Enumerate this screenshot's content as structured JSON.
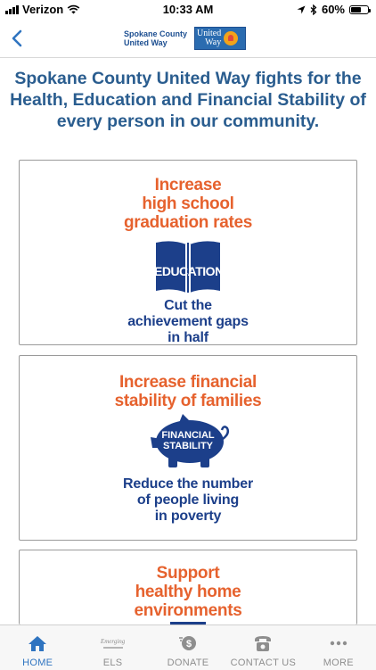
{
  "status_bar": {
    "carrier": "Verizon",
    "time": "10:33 AM",
    "battery": "60%",
    "battery_level": 0.6
  },
  "header": {
    "org_line1": "Spokane County",
    "org_line2": "United Way",
    "logo_line1": "United",
    "logo_line2": "Way"
  },
  "headline": "Spokane County United Way fights for the Health, Education and Financial Stability of every person in our community.",
  "cards": [
    {
      "goal": [
        "Increase",
        "high school",
        "graduation rates"
      ],
      "emblem": "EDUCATION",
      "impact": [
        "Cut the",
        "achievement gaps",
        "in half"
      ]
    },
    {
      "goal": [
        "Increase financial",
        "stability of families"
      ],
      "emblem_line1": "FINANCIAL",
      "emblem_line2": "STABILITY",
      "impact": [
        "Reduce the number",
        "of people living",
        "in poverty"
      ]
    },
    {
      "goal": [
        "Support",
        "healthy home",
        "environments"
      ]
    }
  ],
  "tabs": [
    {
      "label": "HOME",
      "icon": "home-icon",
      "active": true
    },
    {
      "label": "ELS",
      "icon": "emerging-leaders-icon",
      "icon_text": "Emerging"
    },
    {
      "label": "DONATE",
      "icon": "donate-icon"
    },
    {
      "label": "CONTACT US",
      "icon": "phone-icon"
    },
    {
      "label": "MORE",
      "icon": "more-icon"
    }
  ],
  "colors": {
    "headline_blue": "#2a5d8f",
    "goal_orange": "#e6622e",
    "impact_navy": "#1c3f8a",
    "tab_active": "#2f74c0"
  }
}
